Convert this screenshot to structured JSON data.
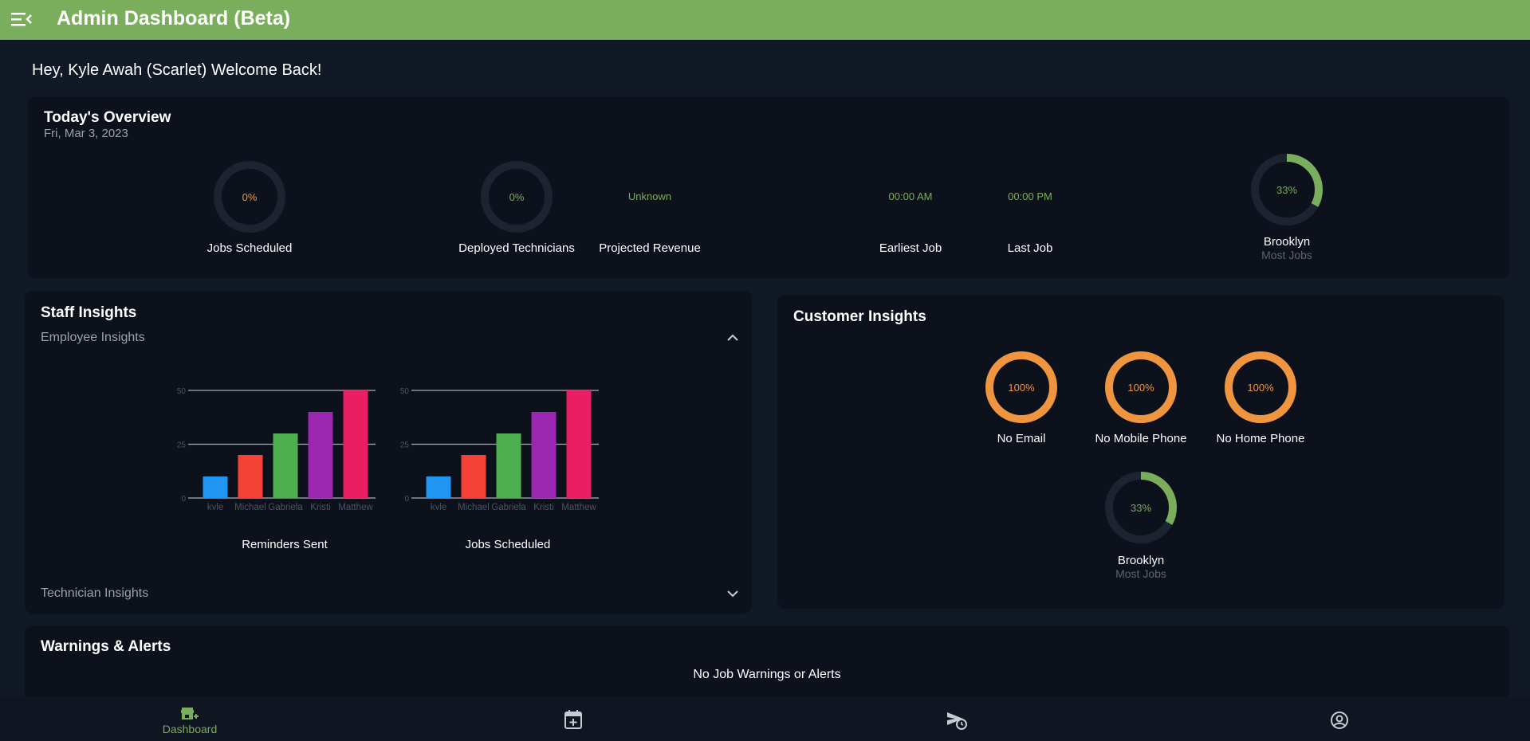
{
  "app": {
    "title": "Admin Dashboard (Beta)"
  },
  "greeting": "Hey, Kyle Awah (Scarlet) Welcome Back!",
  "overview": {
    "title": "Today's Overview",
    "date": "Fri, Mar 3, 2023",
    "jobs_scheduled": {
      "value_text": "0%",
      "value": 0,
      "label": "Jobs Scheduled"
    },
    "deployed_technicians": {
      "value_text": "0%",
      "value": 0,
      "label": "Deployed Technicians"
    },
    "projected_revenue": {
      "value_text": "Unknown",
      "label": "Projected Revenue"
    },
    "earliest_job": {
      "value_text": "00:00 AM",
      "label": "Earliest Job"
    },
    "last_job": {
      "value_text": "00:00 PM",
      "label": "Last Job"
    },
    "top_area": {
      "value_text": "33%",
      "value": 0.33,
      "label": "Brooklyn",
      "sub": "Most Jobs"
    }
  },
  "staff": {
    "title": "Staff Insights",
    "employee_section": "Employee Insights",
    "technician_section": "Technician Insights"
  },
  "chart_data": [
    {
      "type": "bar",
      "title": "Reminders Sent",
      "categories": [
        "kyle",
        "Michael",
        "Gabriela",
        "Kristi",
        "Matthew"
      ],
      "values": [
        10,
        20,
        30,
        40,
        50
      ],
      "yticks": [
        "0",
        "25",
        "50"
      ],
      "ylim": [
        0,
        50
      ],
      "colors": [
        "#2196f3",
        "#f44336",
        "#4caf50",
        "#9c27b0",
        "#e91e63"
      ],
      "grid": true
    },
    {
      "type": "bar",
      "title": "Jobs Scheduled",
      "categories": [
        "kyle",
        "Michael",
        "Gabriela",
        "Kristi",
        "Matthew"
      ],
      "values": [
        10,
        20,
        30,
        40,
        50
      ],
      "yticks": [
        "0",
        "25",
        "50"
      ],
      "ylim": [
        0,
        50
      ],
      "colors": [
        "#2196f3",
        "#f44336",
        "#4caf50",
        "#9c27b0",
        "#e91e63"
      ],
      "grid": true
    }
  ],
  "customer": {
    "title": "Customer Insights",
    "no_email": {
      "value_text": "100%",
      "value": 1.0,
      "label": "No Email"
    },
    "no_mobile": {
      "value_text": "100%",
      "value": 1.0,
      "label": "No Mobile Phone"
    },
    "no_home": {
      "value_text": "100%",
      "value": 1.0,
      "label": "No Home Phone"
    },
    "top_area": {
      "value_text": "33%",
      "value": 0.33,
      "label": "Brooklyn",
      "sub": "Most Jobs"
    }
  },
  "warnings": {
    "title": "Warnings & Alerts",
    "empty_text": "No Job Warnings or Alerts"
  },
  "nav": {
    "dashboard_label": "Dashboard",
    "icons": [
      "dashboard-icon",
      "calendar-add-icon",
      "send-schedule-icon",
      "account-icon"
    ]
  },
  "colors": {
    "accent": "#7aad5c",
    "orange": "#f0953f",
    "ring_track": "#1c2331",
    "background": "#111826",
    "card": "#0c111c"
  }
}
